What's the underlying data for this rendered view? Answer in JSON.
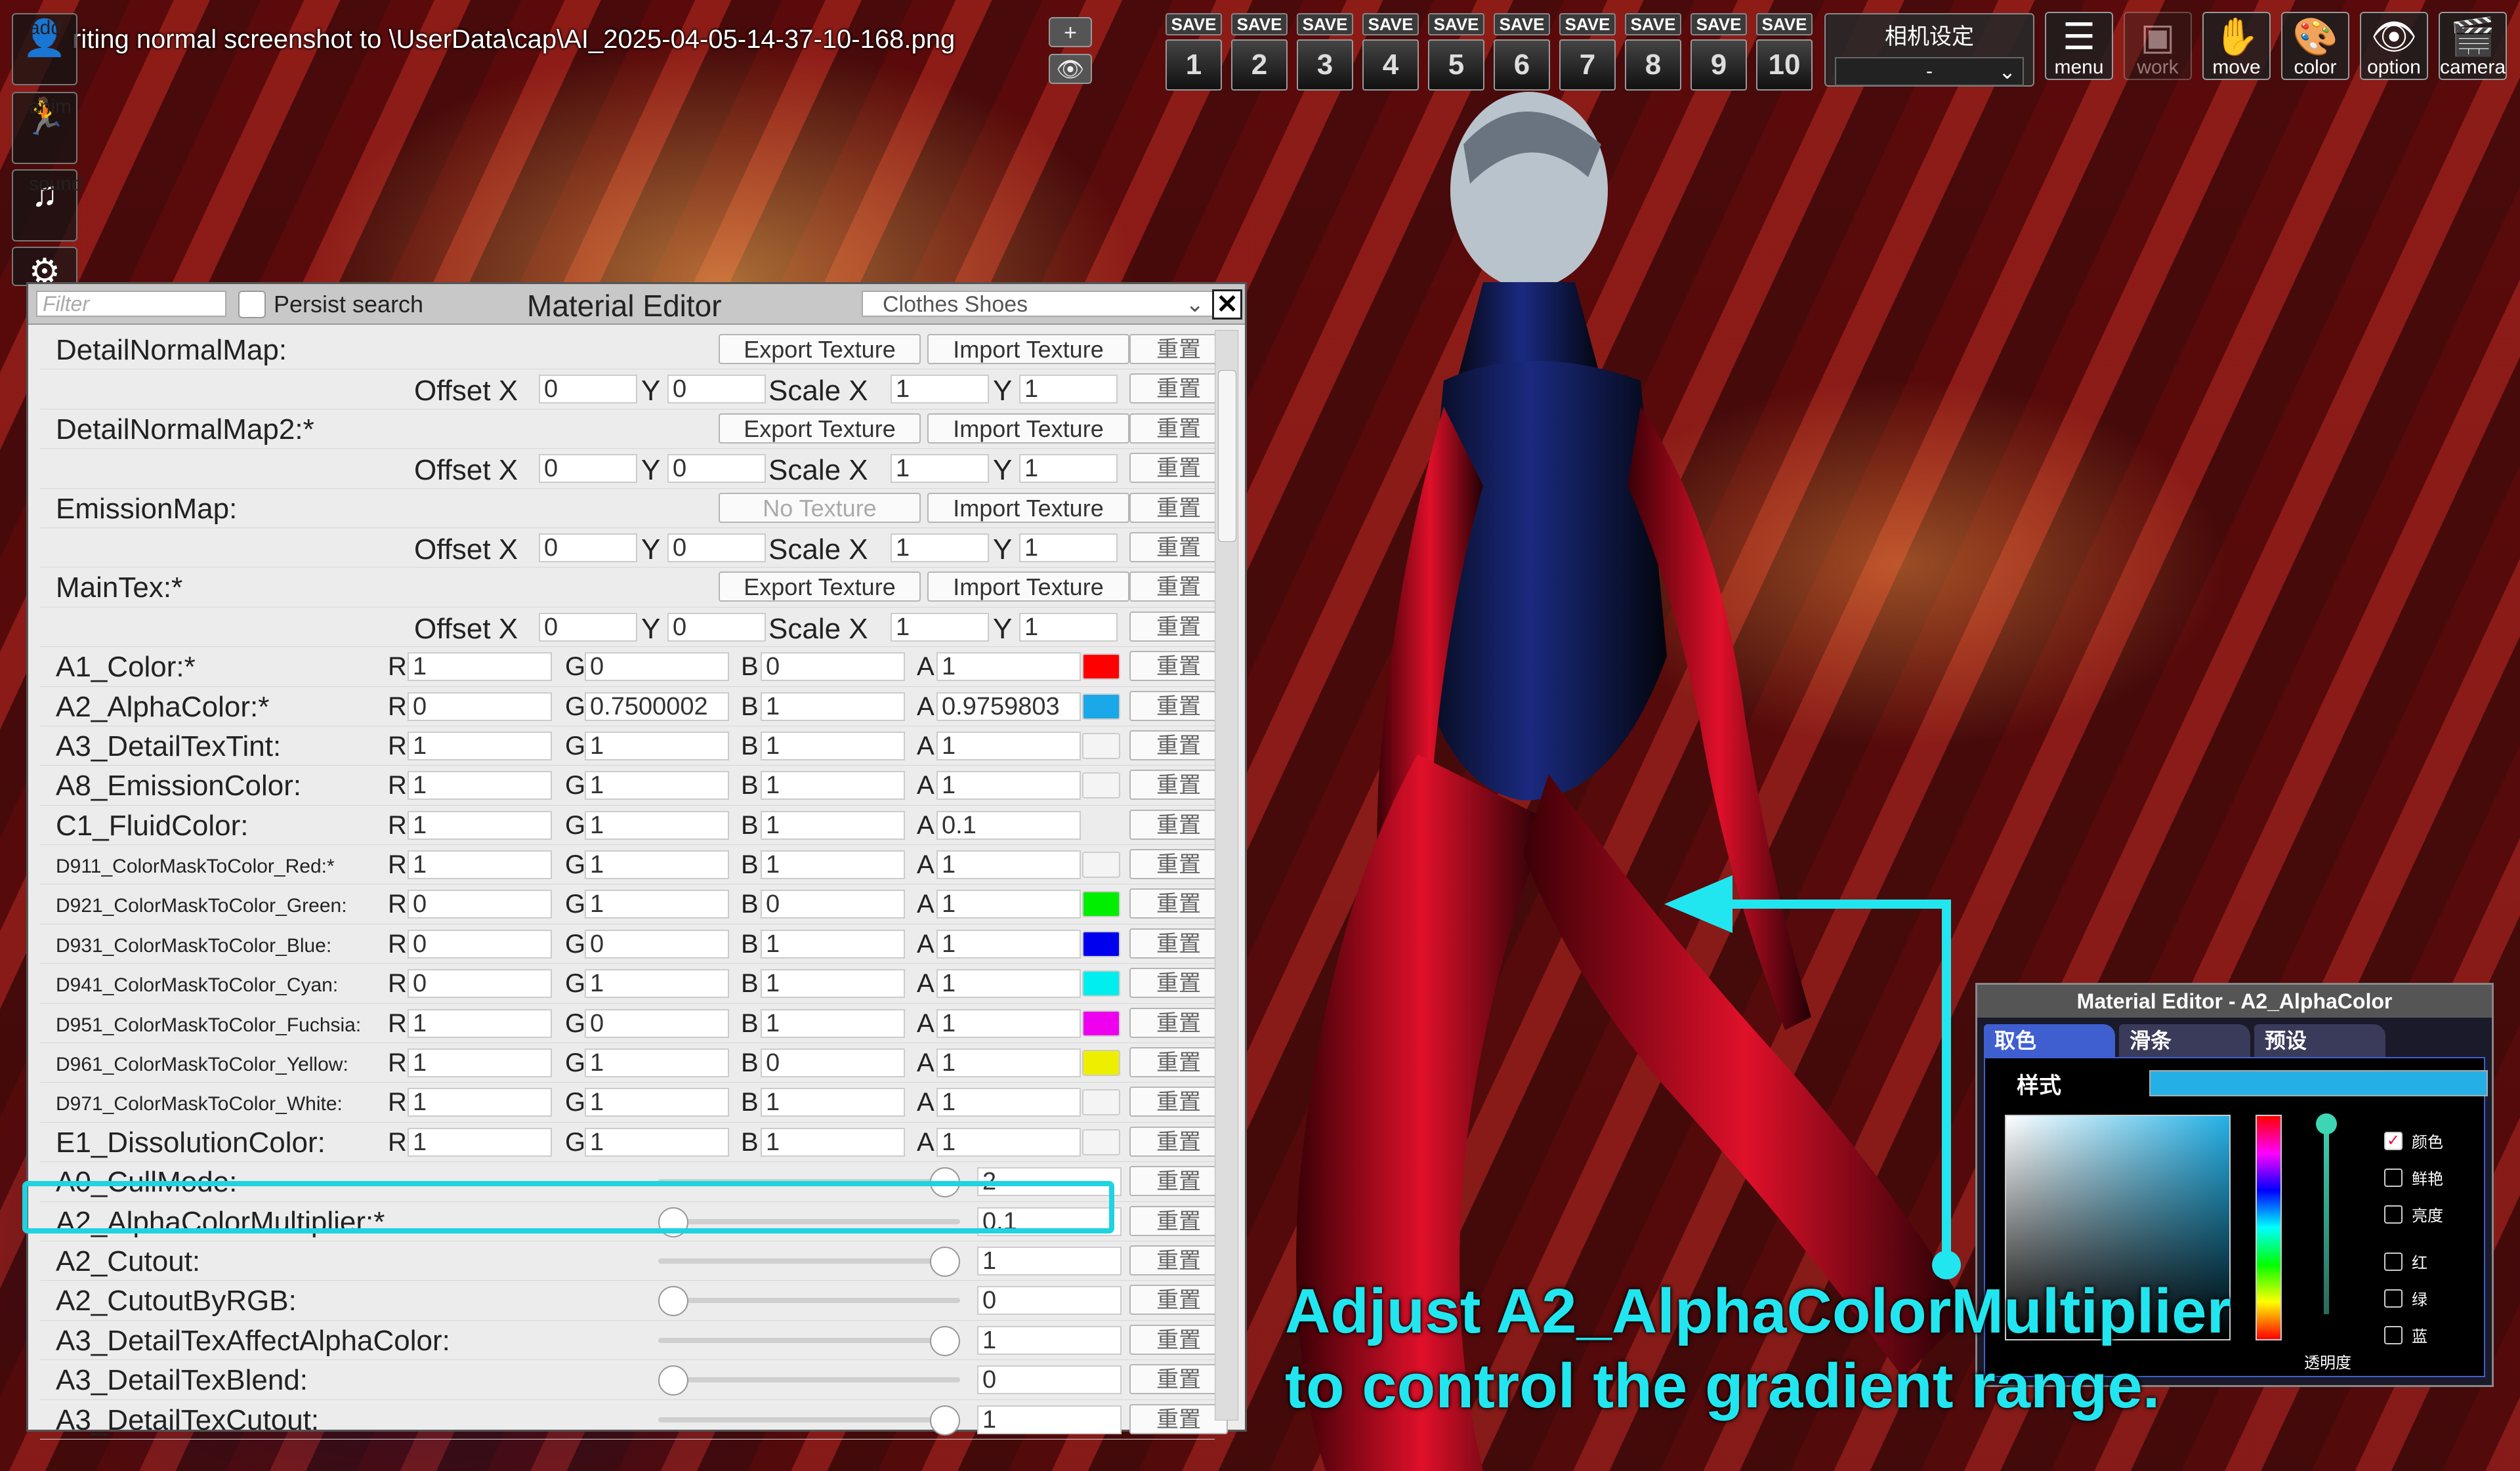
{
  "top_message": "riting normal screenshot to \\UserData\\cap\\AI_2025-04-05-14-37-10-168.png",
  "left_icons": [
    {
      "label": "add",
      "icon": "person-add-icon",
      "glyph": "👤"
    },
    {
      "label": "anim",
      "icon": "running-figure-icon",
      "glyph": "🏃"
    },
    {
      "label": "sound",
      "icon": "music-note-icon",
      "glyph": "♫"
    },
    {
      "label": "",
      "icon": "gear-icon",
      "glyph": "⚙"
    }
  ],
  "mini_buttons": [
    {
      "label": "+",
      "icon": "plus-icon"
    },
    {
      "label": "👁",
      "icon": "eye-icon"
    }
  ],
  "save_slots": [
    {
      "label": "SAVE",
      "num": "1"
    },
    {
      "label": "SAVE",
      "num": "2"
    },
    {
      "label": "SAVE",
      "num": "3"
    },
    {
      "label": "SAVE",
      "num": "4"
    },
    {
      "label": "SAVE",
      "num": "5"
    },
    {
      "label": "SAVE",
      "num": "6"
    },
    {
      "label": "SAVE",
      "num": "7"
    },
    {
      "label": "SAVE",
      "num": "8"
    },
    {
      "label": "SAVE",
      "num": "9"
    },
    {
      "label": "SAVE",
      "num": "10"
    }
  ],
  "camera_setting": {
    "title": "相机设定",
    "value": "-"
  },
  "top_buttons": [
    {
      "label": "menu",
      "icon": "menu-list-icon",
      "glyph": "☰"
    },
    {
      "label": "work",
      "icon": "work-icon",
      "glyph": "▣"
    },
    {
      "label": "move",
      "icon": "hand-move-icon",
      "glyph": "✋"
    },
    {
      "label": "color",
      "icon": "palette-icon",
      "glyph": "🎨"
    },
    {
      "label": "option",
      "icon": "eye-option-icon",
      "glyph": "👁"
    },
    {
      "label": "camera",
      "icon": "clapper-camera-icon",
      "glyph": "🎬"
    }
  ],
  "material_editor": {
    "filter_placeholder": "Filter",
    "persist_label": "Persist search",
    "title": "Material Editor",
    "dropdown": "Clothes Shoes",
    "close": "✕",
    "reset_label": "重置",
    "texture_rows": [
      {
        "label": "DetailNormalMap:",
        "export": "Export Texture",
        "import": "Import Texture",
        "offset_label": "Offset X",
        "y_label": "Y",
        "scale_label": "Scale X",
        "offx": "0",
        "offy": "0",
        "scx": "1",
        "scy": "1"
      },
      {
        "label": "DetailNormalMap2:*",
        "export": "Export Texture",
        "import": "Import Texture",
        "offset_label": "Offset X",
        "y_label": "Y",
        "scale_label": "Scale X",
        "offx": "0",
        "offy": "0",
        "scx": "1",
        "scy": "1"
      },
      {
        "label": "EmissionMap:",
        "export": "No Texture",
        "import": "Import Texture",
        "offset_label": "Offset X",
        "y_label": "Y",
        "scale_label": "Scale X",
        "offx": "0",
        "offy": "0",
        "scx": "1",
        "scy": "1"
      },
      {
        "label": "MainTex:*",
        "export": "Export Texture",
        "import": "Import Texture",
        "offset_label": "Offset X",
        "y_label": "Y",
        "scale_label": "Scale X",
        "offx": "0",
        "offy": "0",
        "scx": "1",
        "scy": "1"
      }
    ],
    "color_rows": [
      {
        "label": "A1_Color:*",
        "r": "1",
        "g": "0",
        "b": "0",
        "a": "1",
        "swatch": "#ff0000",
        "small": false
      },
      {
        "label": "A2_AlphaColor:*",
        "r": "0",
        "g": "0.7500002",
        "b": "1",
        "a": "0.9759803",
        "swatch": "#1aa8e8",
        "small": false
      },
      {
        "label": "A3_DetailTexTint:",
        "r": "1",
        "g": "1",
        "b": "1",
        "a": "1",
        "swatch": "#f4f4f4",
        "small": false
      },
      {
        "label": "A8_EmissionColor:",
        "r": "1",
        "g": "1",
        "b": "1",
        "a": "1",
        "swatch": "#f4f4f4",
        "small": false
      },
      {
        "label": "C1_FluidColor:",
        "r": "1",
        "g": "1",
        "b": "1",
        "a": "0.1",
        "swatch": "",
        "small": false
      },
      {
        "label": "D911_ColorMaskToColor_Red:*",
        "r": "1",
        "g": "1",
        "b": "1",
        "a": "1",
        "swatch": "#f4f4f4",
        "small": true
      },
      {
        "label": "D921_ColorMaskToColor_Green:",
        "r": "0",
        "g": "1",
        "b": "0",
        "a": "1",
        "swatch": "#00ee00",
        "small": true
      },
      {
        "label": "D931_ColorMaskToColor_Blue:",
        "r": "0",
        "g": "0",
        "b": "1",
        "a": "1",
        "swatch": "#0000ee",
        "small": true
      },
      {
        "label": "D941_ColorMaskToColor_Cyan:",
        "r": "0",
        "g": "1",
        "b": "1",
        "a": "1",
        "swatch": "#00eeee",
        "small": true
      },
      {
        "label": "D951_ColorMaskToColor_Fuchsia:",
        "r": "1",
        "g": "0",
        "b": "1",
        "a": "1",
        "swatch": "#ee00ee",
        "small": true
      },
      {
        "label": "D961_ColorMaskToColor_Yellow:",
        "r": "1",
        "g": "1",
        "b": "0",
        "a": "1",
        "swatch": "#eeee00",
        "small": true
      },
      {
        "label": "D971_ColorMaskToColor_White:",
        "r": "1",
        "g": "1",
        "b": "1",
        "a": "1",
        "swatch": "#f4f4f4",
        "small": true
      },
      {
        "label": "E1_DissolutionColor:",
        "r": "1",
        "g": "1",
        "b": "1",
        "a": "1",
        "swatch": "#f4f4f4",
        "small": false
      }
    ],
    "channel_labels": {
      "r": "R",
      "g": "G",
      "b": "B",
      "a": "A"
    },
    "slider_rows": [
      {
        "label": "A0_CullMode:",
        "value": "2",
        "level": 1.0
      },
      {
        "label": "A2_AlphaColorMultiplier:*",
        "value": "0.1",
        "level": 0.0
      },
      {
        "label": "A2_Cutout:",
        "value": "1",
        "level": 1.0
      },
      {
        "label": "A2_CutoutByRGB:",
        "value": "0",
        "level": 0.0
      },
      {
        "label": "A3_DetailTexAffectAlphaColor:",
        "value": "1",
        "level": 1.0
      },
      {
        "label": "A3_DetailTexBlend:",
        "value": "0",
        "level": 0.0
      },
      {
        "label": "A3_DetailTexCutout:",
        "value": "1",
        "level": 1.0
      }
    ]
  },
  "color_picker": {
    "title": "Material Editor - A2_AlphaColor",
    "tabs": [
      "取色",
      "滑条",
      "预设"
    ],
    "style_label": "样式",
    "color": "#24b0e6",
    "alpha_label": "透明度",
    "options": [
      {
        "label": "颜色",
        "checked": true
      },
      {
        "label": "鲜艳",
        "checked": false
      },
      {
        "label": "亮度",
        "checked": false
      },
      {
        "label": "红",
        "checked": false
      },
      {
        "label": "绿",
        "checked": false
      },
      {
        "label": "蓝",
        "checked": false
      }
    ]
  },
  "annotation": {
    "line1": "Adjust A2_AlphaColorMultiplier",
    "line2": "to control the gradient range.",
    "color": "#22e6ef"
  }
}
